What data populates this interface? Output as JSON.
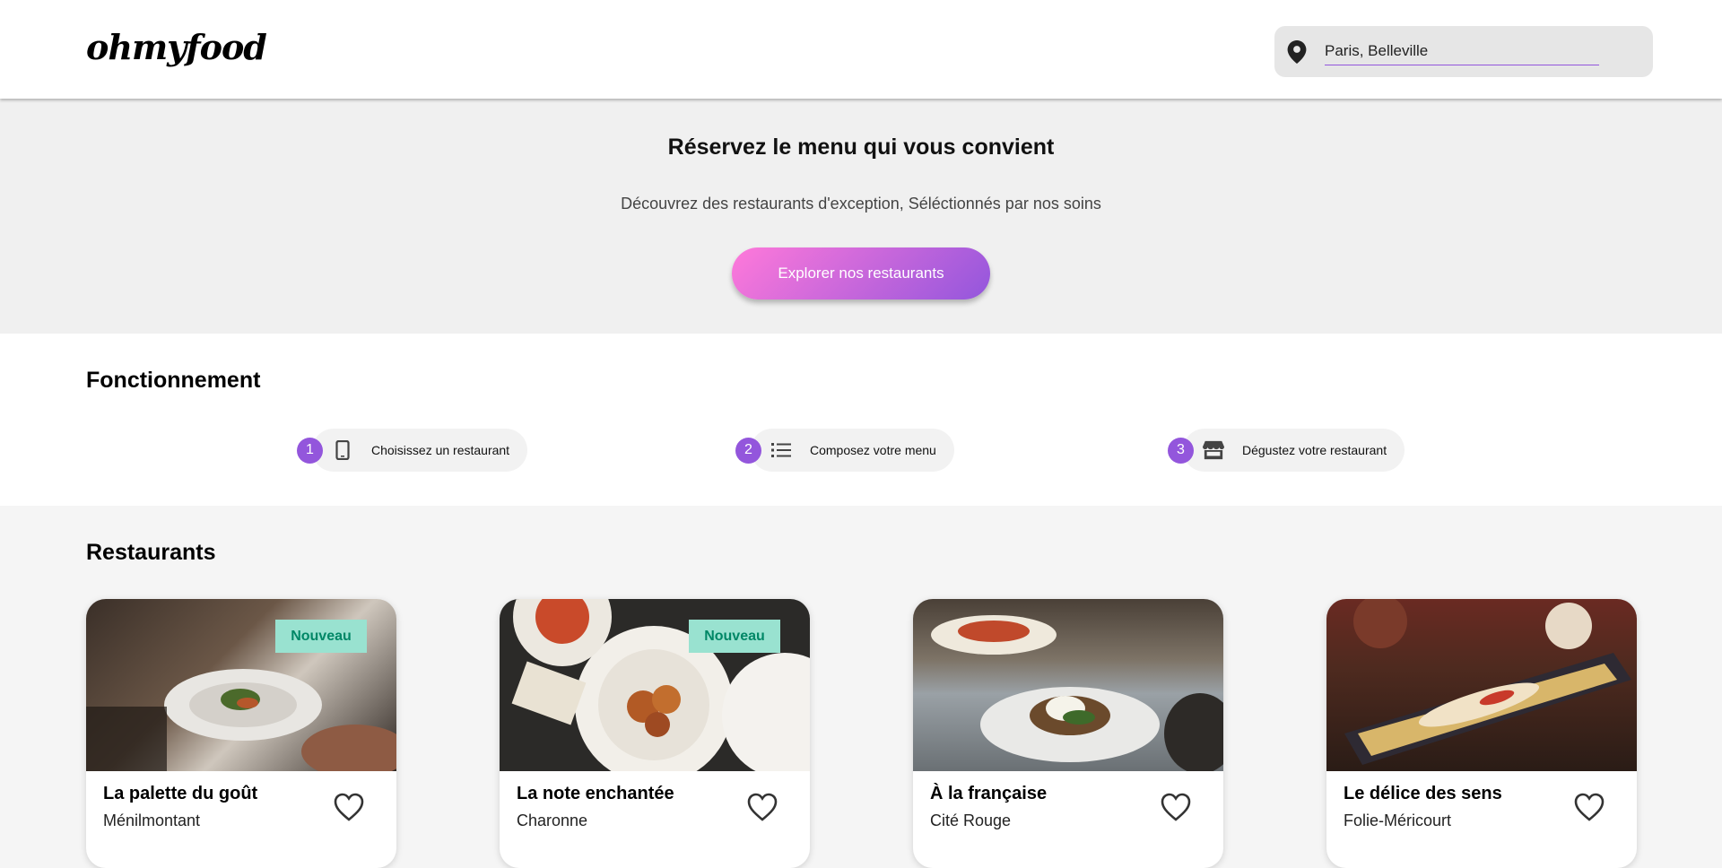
{
  "header": {
    "logo": "ohmyfood",
    "location": {
      "value": "Paris, Belleville",
      "icon": "map-pin-icon"
    }
  },
  "hero": {
    "title": "Réservez le menu qui vous convient",
    "subtitle": "Découvrez des restaurants d'exception, Séléctionnés par nos soins",
    "cta_label": "Explorer nos restaurants"
  },
  "how": {
    "title": "Fonctionnement",
    "steps": [
      {
        "number": "1",
        "icon": "mobile-phone-icon",
        "label": "Choisissez un restaurant"
      },
      {
        "number": "2",
        "icon": "list-icon",
        "label": "Composez votre menu"
      },
      {
        "number": "3",
        "icon": "store-icon",
        "label": "Dégustez votre restaurant"
      }
    ]
  },
  "restaurants": {
    "title": "Restaurants",
    "items": [
      {
        "name": "La palette du goût",
        "area": "Ménilmontant",
        "badge": "Nouveau"
      },
      {
        "name": "La note enchantée",
        "area": "Charonne",
        "badge": "Nouveau"
      },
      {
        "name": "À la française",
        "area": "Cité Rouge",
        "badge": ""
      },
      {
        "name": "Le délice des sens",
        "area": "Folie-Méricourt",
        "badge": ""
      }
    ]
  },
  "colors": {
    "primary_purple": "#9356dc",
    "primary_pink": "#ff79da",
    "badge_bg": "#99e2d0",
    "badge_text": "#008766"
  }
}
